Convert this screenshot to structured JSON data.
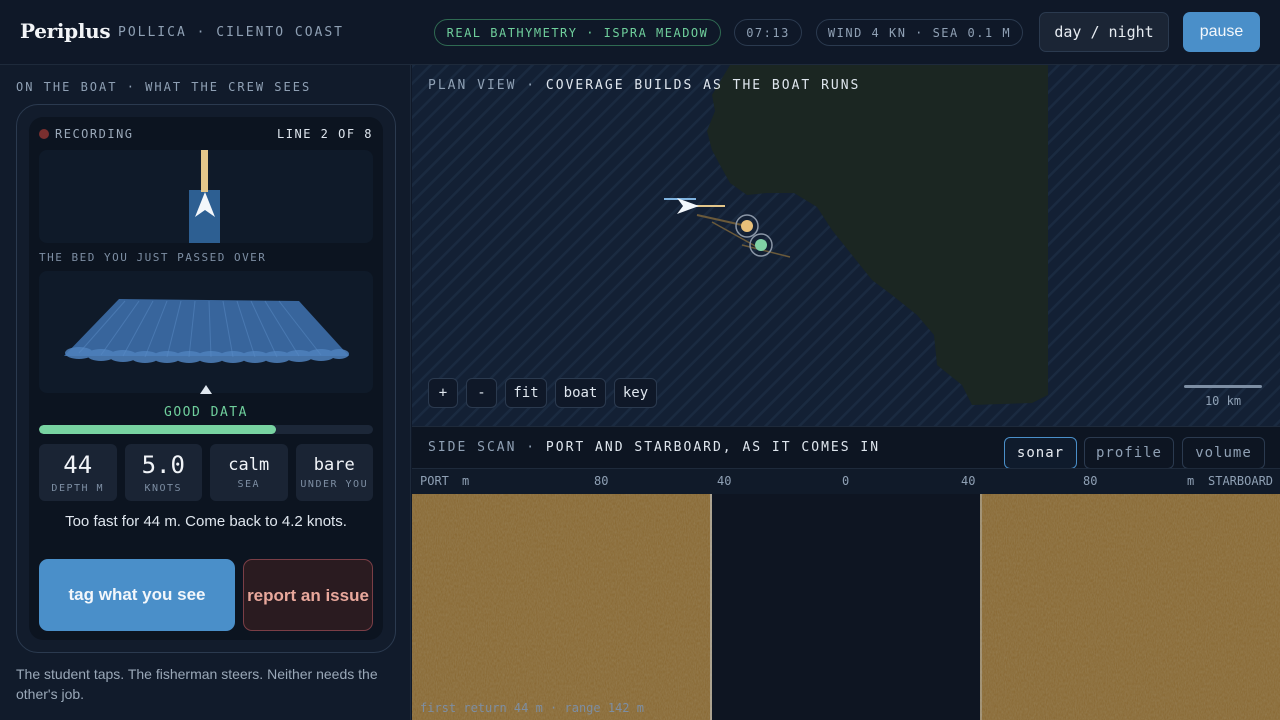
{
  "header": {
    "brand": "Periplus",
    "location": "POLLICA · CILENTO COAST",
    "data_source": "REAL BATHYMETRY · ISPRA MEADOW",
    "clock": "07:13",
    "conditions": "WIND 4 KN · SEA 0.1 M",
    "day_night_label": "day / night",
    "pause_label": "pause"
  },
  "left": {
    "caption": "ON THE BOAT · WHAT THE CREW SEES",
    "device": {
      "status": "RECORDING",
      "line": "LINE 2 OF 8",
      "bed_caption": "THE BED YOU JUST PASSED OVER",
      "quality_label": "GOOD DATA",
      "quality_fraction": 0.71,
      "stats": [
        {
          "value": "44",
          "label": "DEPTH M"
        },
        {
          "value": "5.0",
          "label": "KNOTS"
        },
        {
          "value": "calm",
          "label": "SEA"
        },
        {
          "value": "bare",
          "label": "UNDER YOU"
        }
      ],
      "advice": "Too fast for 44 m. Come back to 4.2 knots.",
      "tag_label": "tag what you see",
      "report_label": "report an issue"
    },
    "footnote": "The student taps. The fisherman steers. Neither needs the other's job."
  },
  "plan": {
    "caption_dim": "PLAN VIEW · ",
    "caption": "COVERAGE BUILDS AS THE BOAT RUNS",
    "controls": [
      "+",
      "-",
      "fit",
      "boat",
      "key"
    ],
    "scale_label": "10 km"
  },
  "scan": {
    "caption_dim": "SIDE SCAN · ",
    "caption": "PORT AND STARBOARD, AS IT COMES IN",
    "tabs": [
      "sonar",
      "profile",
      "volume"
    ],
    "active_tab": "sonar",
    "axis": {
      "port": "PORT",
      "unit": "m",
      "starboard": "STARBOARD",
      "ticks": [
        "80",
        "40",
        "0",
        "40",
        "80"
      ]
    },
    "footer": "first return 44 m  ·  range 142 m"
  },
  "colors": {
    "accent": "#4a8fc9",
    "good": "#6fcf9c",
    "land": "#1b2622",
    "sea": "#132034",
    "seabed": "#8a6a35",
    "recording": "#7a2f2f",
    "warning": "#e9a89c"
  }
}
